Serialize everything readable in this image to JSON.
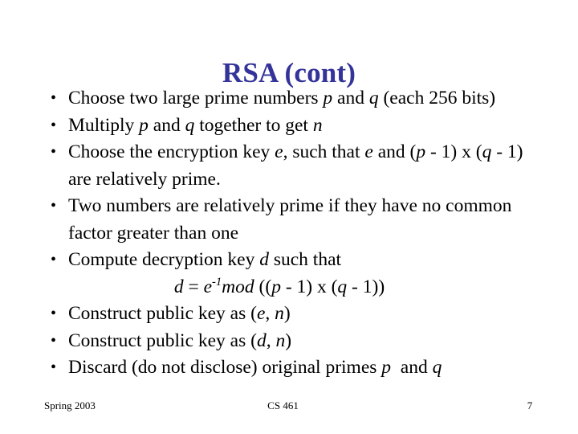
{
  "slide": {
    "title": "RSA (cont)",
    "title_color": "#333399",
    "background_color": "#ffffff",
    "text_color": "#000000",
    "bullet_marker": "•",
    "bullets": [
      {
        "id": "choose-primes",
        "lines": [
          {
            "type": "text",
            "segments": [
              {
                "text": "Choose two large prime numbers ",
                "style": "roman"
              },
              {
                "text": "p",
                "style": "italic"
              },
              {
                "text": " and ",
                "style": "roman"
              },
              {
                "text": "q",
                "style": "italic"
              },
              {
                "text": " (each 256 bits)",
                "style": "roman"
              }
            ],
            "plain": "Choose two large prime numbers p and q (each 256 bits)"
          }
        ]
      },
      {
        "id": "multiply-get-n",
        "lines": [
          {
            "type": "text",
            "segments": [
              {
                "text": "Multiply ",
                "style": "roman"
              },
              {
                "text": "p",
                "style": "italic"
              },
              {
                "text": " and ",
                "style": "roman"
              },
              {
                "text": "q",
                "style": "italic"
              },
              {
                "text": " together to get ",
                "style": "roman"
              },
              {
                "text": "n",
                "style": "italic"
              }
            ],
            "plain": "Multiply p and q together to get n"
          }
        ]
      },
      {
        "id": "choose-encryption-key",
        "lines": [
          {
            "type": "text",
            "segments": [
              {
                "text": "Choose the encryption key ",
                "style": "roman"
              },
              {
                "text": "e",
                "style": "italic"
              },
              {
                "text": ", such that ",
                "style": "roman"
              },
              {
                "text": "e",
                "style": "italic"
              },
              {
                "text": " and (",
                "style": "roman"
              },
              {
                "text": "p",
                "style": "italic"
              },
              {
                "text": " - 1) ",
                "style": "roman"
              },
              {
                "text": "x",
                "style": "times"
              },
              {
                "text": " (",
                "style": "roman"
              },
              {
                "text": "q",
                "style": "italic"
              },
              {
                "text": " - 1)",
                "style": "roman"
              }
            ],
            "plain": "Choose the encryption key e, such that e and (p - 1) x (q - 1)"
          },
          {
            "type": "text",
            "segments": [
              {
                "text": "are relatively prime.",
                "style": "roman"
              }
            ],
            "plain": "are relatively prime."
          }
        ]
      },
      {
        "id": "relatively-prime-definition",
        "lines": [
          {
            "type": "text",
            "segments": [
              {
                "text": "Two numbers are relatively prime if they have no common",
                "style": "roman"
              }
            ],
            "plain": "Two numbers are relatively prime if they have no common"
          },
          {
            "type": "text",
            "segments": [
              {
                "text": "factor greater than one",
                "style": "roman"
              }
            ],
            "plain": "factor greater than one"
          }
        ]
      },
      {
        "id": "compute-decryption-key",
        "lines": [
          {
            "type": "text",
            "segments": [
              {
                "text": "Compute decryption key ",
                "style": "roman"
              },
              {
                "text": "d",
                "style": "italic"
              },
              {
                "text": " such that",
                "style": "roman"
              }
            ],
            "plain": "Compute decryption key d such that"
          },
          {
            "type": "formula",
            "segments": [
              {
                "text": "d",
                "style": "italic"
              },
              {
                "text": " = ",
                "style": "roman"
              },
              {
                "text": "e",
                "style": "italic"
              },
              {
                "text": "-1",
                "style": "superscript"
              },
              {
                "text": "mod",
                "style": "italic"
              },
              {
                "text": " ((",
                "style": "roman"
              },
              {
                "text": "p",
                "style": "italic"
              },
              {
                "text": " - 1) ",
                "style": "roman"
              },
              {
                "text": "x",
                "style": "times"
              },
              {
                "text": " (",
                "style": "roman"
              },
              {
                "text": "q",
                "style": "italic"
              },
              {
                "text": " - 1))",
                "style": "roman"
              }
            ],
            "plain": "d = e-1mod ((p - 1) x (q - 1))"
          }
        ]
      },
      {
        "id": "construct-public-key-en",
        "lines": [
          {
            "type": "text",
            "segments": [
              {
                "text": "Construct public key as (",
                "style": "roman"
              },
              {
                "text": "e",
                "style": "italic"
              },
              {
                "text": ", ",
                "style": "roman"
              },
              {
                "text": "n",
                "style": "italic"
              },
              {
                "text": ")",
                "style": "roman"
              }
            ],
            "plain": "Construct public key as (e, n)"
          }
        ]
      },
      {
        "id": "construct-public-key-dn",
        "lines": [
          {
            "type": "text",
            "segments": [
              {
                "text": "Construct public key as (",
                "style": "roman"
              },
              {
                "text": "d",
                "style": "italic"
              },
              {
                "text": ", ",
                "style": "roman"
              },
              {
                "text": "n",
                "style": "italic"
              },
              {
                "text": ")",
                "style": "roman"
              }
            ],
            "plain": "Construct public key as (d, n)"
          }
        ]
      },
      {
        "id": "discard-primes",
        "lines": [
          {
            "type": "text",
            "segments": [
              {
                "text": "Discard (do not disclose) original primes ",
                "style": "roman"
              },
              {
                "text": "p",
                "style": "italic"
              },
              {
                "text": "  and ",
                "style": "roman"
              },
              {
                "text": "q",
                "style": "italic"
              }
            ],
            "plain": "Discard (do not disclose) original primes p  and q"
          }
        ]
      }
    ]
  },
  "footer": {
    "date": "Spring 2003",
    "course": "CS 461",
    "page_number": "7"
  }
}
